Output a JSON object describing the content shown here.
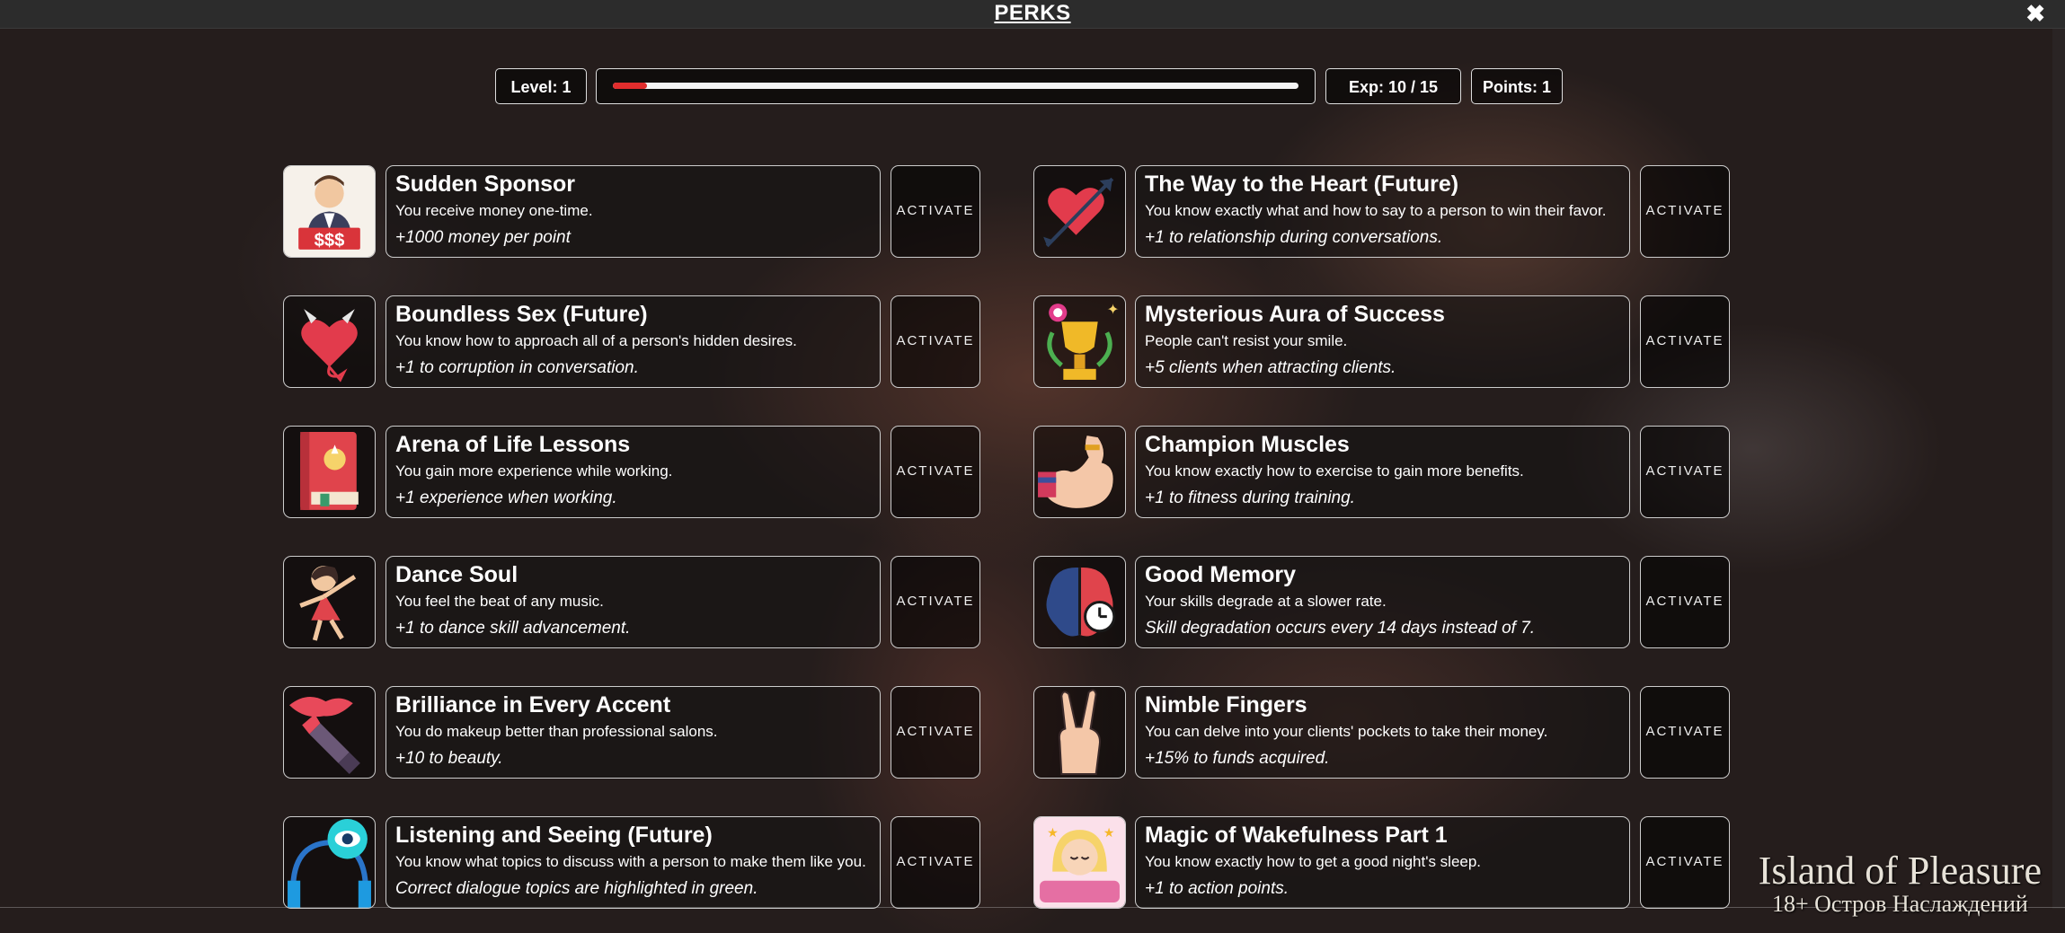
{
  "header": {
    "title": "PERKS",
    "close_icon": "close-icon"
  },
  "stats": {
    "level_label": "Level: 1",
    "exp_label": "Exp: 10 / 15",
    "points_label": "Points: 1",
    "progress_fraction": 0.05
  },
  "activate_label": "ACTIVATE",
  "perks_left": [
    {
      "icon": "businessman-money-icon",
      "title": "Sudden Sponsor",
      "desc": "You receive money one-time.",
      "bonus": "+1000 money per point"
    },
    {
      "icon": "devil-heart-icon",
      "title": "Boundless Sex (Future)",
      "desc": "You know how to approach all of a person's hidden desires.",
      "bonus": "+1 to corruption in conversation."
    },
    {
      "icon": "book-icon",
      "title": "Arena of Life Lessons",
      "desc": "You gain more experience while working.",
      "bonus": "+1 experience when working."
    },
    {
      "icon": "dancing-girl-icon",
      "title": "Dance Soul",
      "desc": "You feel the beat of any music.",
      "bonus": "+1 to dance skill advancement."
    },
    {
      "icon": "lipstick-icon",
      "title": "Brilliance in Every Accent",
      "desc": "You do makeup better than professional salons.",
      "bonus": "+10 to beauty."
    },
    {
      "icon": "headphones-eye-icon",
      "title": "Listening and Seeing (Future)",
      "desc": "You know what topics to discuss with a person to make them like you.",
      "bonus": "Correct dialogue topics are highlighted in green."
    }
  ],
  "perks_right": [
    {
      "icon": "heart-arrow-icon",
      "title": "The Way to the Heart (Future)",
      "desc": "You know exactly what and how to say to a person to win their favor.",
      "bonus": "+1 to relationship during conversations."
    },
    {
      "icon": "trophy-icon",
      "title": "Mysterious Aura of Success",
      "desc": "People can't resist your smile.",
      "bonus": "+5 clients when attracting clients."
    },
    {
      "icon": "muscle-arm-icon",
      "title": "Champion Muscles",
      "desc": "You know exactly how to exercise to gain more benefits.",
      "bonus": "+1 to fitness during training."
    },
    {
      "icon": "brain-clock-icon",
      "title": "Good Memory",
      "desc": "Your skills degrade at a slower rate.",
      "bonus": "Skill degradation occurs every 14 days instead of 7."
    },
    {
      "icon": "hand-fingers-icon",
      "title": "Nimble Fingers",
      "desc": "You can delve into your clients' pockets to take their money.",
      "bonus": "+15% to funds acquired."
    },
    {
      "icon": "sleeping-girl-icon",
      "title": "Magic of Wakefulness Part 1",
      "desc": "You know exactly how to get a good night's sleep.",
      "bonus": "+1 to action points."
    }
  ],
  "watermark": {
    "line1": "Island of Pleasure",
    "line2": "18+ Остров Наслаждений"
  }
}
